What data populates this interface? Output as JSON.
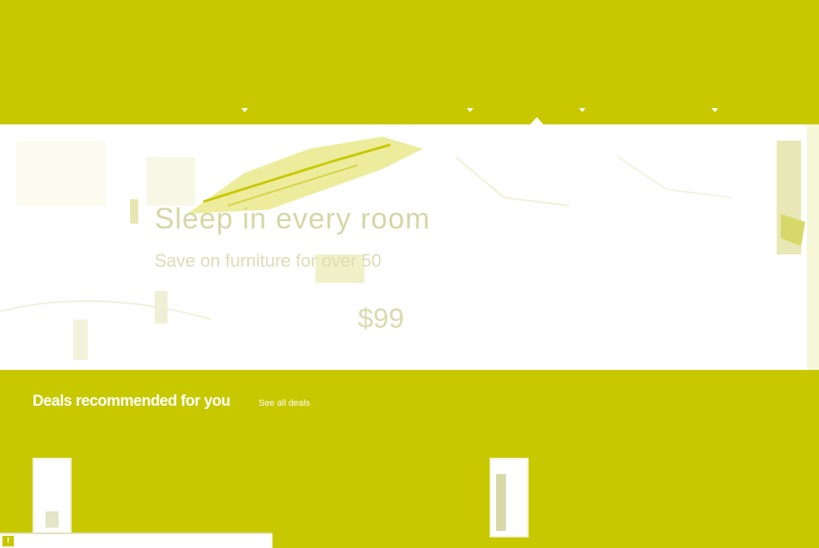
{
  "hero": {
    "heading": "Sleep in every room",
    "subheading": "Save on furniture for over 50",
    "price": "$99"
  },
  "deals": {
    "title": "Deals recommended for you",
    "see_all_label": "See all deals"
  },
  "colors": {
    "page_background": "#c8c800",
    "hero_background": "#ffffff",
    "text_on_accent": "#ffffff"
  },
  "icons": {
    "nav_dropdown": "chevron-down-icon",
    "notice": "warning-icon"
  }
}
